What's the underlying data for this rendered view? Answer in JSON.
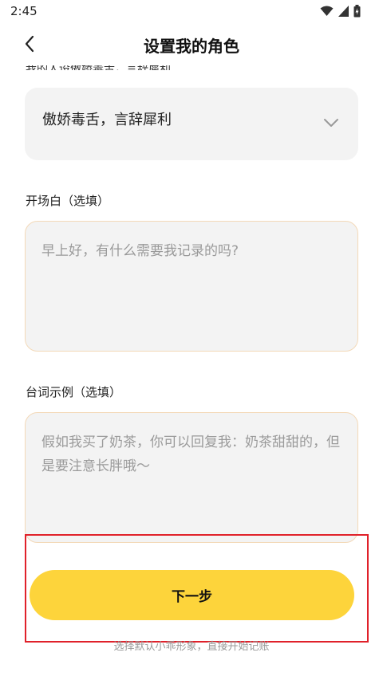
{
  "status_bar": {
    "time": "2:45"
  },
  "header": {
    "title": "设置我的角色"
  },
  "persona_section": {
    "label_partial": "我的人设傲娇毒舌，言辞犀利",
    "selected_value": "傲娇毒舌，言辞犀利"
  },
  "opening_line": {
    "label": "开场白（选填）",
    "placeholder": "早上好，有什么需要我记录的吗?"
  },
  "dialogue_example": {
    "label": "台词示例（选填）",
    "placeholder": "假如我买了奶茶，你可以回复我：奶茶甜甜的，但是要注意长胖哦～"
  },
  "footer": {
    "next_button_label": "下一步",
    "skip_hint": "选择默认小乖形象，直接开始记账"
  },
  "colors": {
    "accent": "#fdd43b",
    "input_border": "#f3d9b8",
    "highlight_box": "#e0212a"
  },
  "icons": [
    "back-chevron-icon",
    "chevron-down-icon",
    "wifi-icon",
    "cellular-icon",
    "battery-icon"
  ]
}
